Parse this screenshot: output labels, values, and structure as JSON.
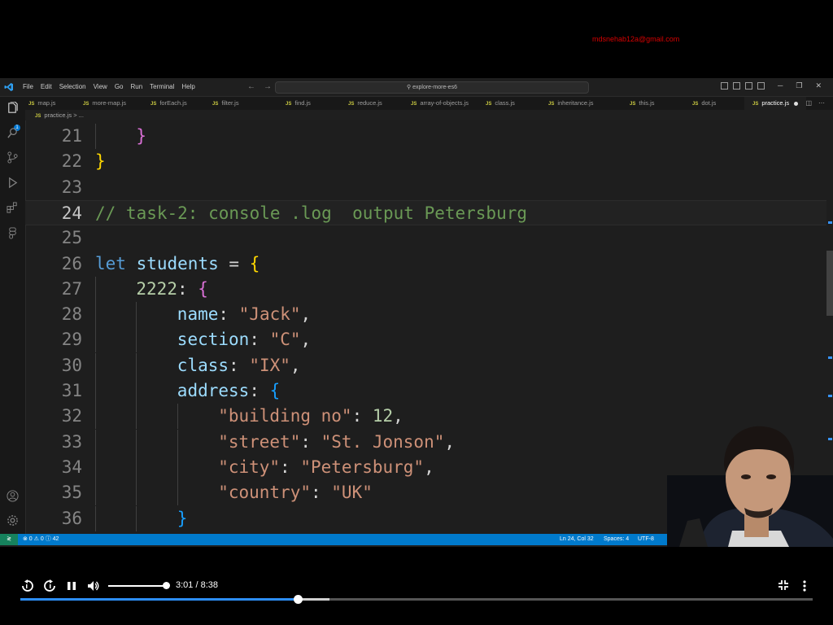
{
  "overlay": {
    "email": "mdsnehab12a@gmail.com"
  },
  "titlebar": {
    "menu": [
      "File",
      "Edit",
      "Selection",
      "View",
      "Go",
      "Run",
      "Terminal",
      "Help"
    ],
    "search": "explore-more-es6"
  },
  "activity_bar": {
    "icons": [
      "explorer-icon",
      "search-icon",
      "source-control-icon",
      "run-debug-icon",
      "extensions-icon",
      "figma-icon",
      "account-icon",
      "settings-gear-icon"
    ],
    "explorer_badge": "1"
  },
  "tabs": [
    {
      "label": "map.js",
      "active": false
    },
    {
      "label": "more-map.js",
      "active": false
    },
    {
      "label": "forEach.js",
      "active": false
    },
    {
      "label": "filter.js",
      "active": false
    },
    {
      "label": "find.js",
      "active": false
    },
    {
      "label": "reduce.js",
      "active": false
    },
    {
      "label": "array-of-objects.js",
      "active": false
    },
    {
      "label": "class.js",
      "active": false
    },
    {
      "label": "inheritance.js",
      "active": false
    },
    {
      "label": "this.js",
      "active": false
    },
    {
      "label": "dot.js",
      "active": false
    },
    {
      "label": "practice.js",
      "active": true,
      "modified": true
    }
  ],
  "tab_icon_text": "JS",
  "breadcrumb": {
    "file": "practice.js",
    "sep": ">",
    "rest": "..."
  },
  "editor": {
    "current_line": 24,
    "lines": [
      {
        "n": "21",
        "indent": 1,
        "tokens": [
          {
            "t": "}",
            "c": "c-b2"
          }
        ]
      },
      {
        "n": "22",
        "indent": 0,
        "tokens": [
          {
            "t": "}",
            "c": "c-b1"
          }
        ]
      },
      {
        "n": "23",
        "indent": 0,
        "tokens": []
      },
      {
        "n": "24",
        "indent": 0,
        "tokens": [
          {
            "t": "// task-2: console .log  output Petersburg",
            "c": "c-comment"
          }
        ]
      },
      {
        "n": "25",
        "indent": 0,
        "tokens": []
      },
      {
        "n": "26",
        "indent": 0,
        "tokens": [
          {
            "t": "let",
            "c": "c-kw"
          },
          {
            "t": " "
          },
          {
            "t": "students",
            "c": "c-var"
          },
          {
            "t": " = "
          },
          {
            "t": "{",
            "c": "c-b1"
          }
        ]
      },
      {
        "n": "27",
        "indent": 1,
        "tokens": [
          {
            "t": "2222",
            "c": "c-num"
          },
          {
            "t": ": "
          },
          {
            "t": "{",
            "c": "c-b2"
          }
        ]
      },
      {
        "n": "28",
        "indent": 2,
        "tokens": [
          {
            "t": "name",
            "c": "c-var"
          },
          {
            "t": ": "
          },
          {
            "t": "\"Jack\"",
            "c": "c-str"
          },
          {
            "t": ","
          }
        ]
      },
      {
        "n": "29",
        "indent": 2,
        "tokens": [
          {
            "t": "section",
            "c": "c-var"
          },
          {
            "t": ": "
          },
          {
            "t": "\"C\"",
            "c": "c-str"
          },
          {
            "t": ","
          }
        ]
      },
      {
        "n": "30",
        "indent": 2,
        "tokens": [
          {
            "t": "class",
            "c": "c-var"
          },
          {
            "t": ": "
          },
          {
            "t": "\"IX\"",
            "c": "c-str"
          },
          {
            "t": ","
          }
        ]
      },
      {
        "n": "31",
        "indent": 2,
        "tokens": [
          {
            "t": "address",
            "c": "c-var"
          },
          {
            "t": ": "
          },
          {
            "t": "{",
            "c": "c-b3"
          }
        ]
      },
      {
        "n": "32",
        "indent": 3,
        "tokens": [
          {
            "t": "\"building no\"",
            "c": "c-str"
          },
          {
            "t": ": "
          },
          {
            "t": "12",
            "c": "c-num"
          },
          {
            "t": ","
          }
        ]
      },
      {
        "n": "33",
        "indent": 3,
        "tokens": [
          {
            "t": "\"street\"",
            "c": "c-str"
          },
          {
            "t": ": "
          },
          {
            "t": "\"St. Jonson\"",
            "c": "c-str"
          },
          {
            "t": ","
          }
        ]
      },
      {
        "n": "34",
        "indent": 3,
        "tokens": [
          {
            "t": "\"city\"",
            "c": "c-str"
          },
          {
            "t": ": "
          },
          {
            "t": "\"Petersburg\"",
            "c": "c-str"
          },
          {
            "t": ","
          }
        ]
      },
      {
        "n": "35",
        "indent": 3,
        "tokens": [
          {
            "t": "\"country\"",
            "c": "c-str"
          },
          {
            "t": ": "
          },
          {
            "t": "\"UK\"",
            "c": "c-str"
          }
        ]
      },
      {
        "n": "36",
        "indent": 2,
        "tokens": [
          {
            "t": "}",
            "c": "c-b3"
          }
        ]
      }
    ]
  },
  "statusbar": {
    "problems": "⊗ 0 ⚠ 0 ⓘ 42",
    "cursor": "Ln 24, Col 32",
    "spaces": "Spaces: 4",
    "encoding": "UTF-8"
  },
  "player": {
    "time": "3:01 / 8:38",
    "played_fraction": 0.35,
    "buffered_fraction": 0.39,
    "volume_fraction": 0.95
  },
  "colors": {
    "accent": "#007acc",
    "progress": "#2d8ef7",
    "email": "#d60000"
  }
}
